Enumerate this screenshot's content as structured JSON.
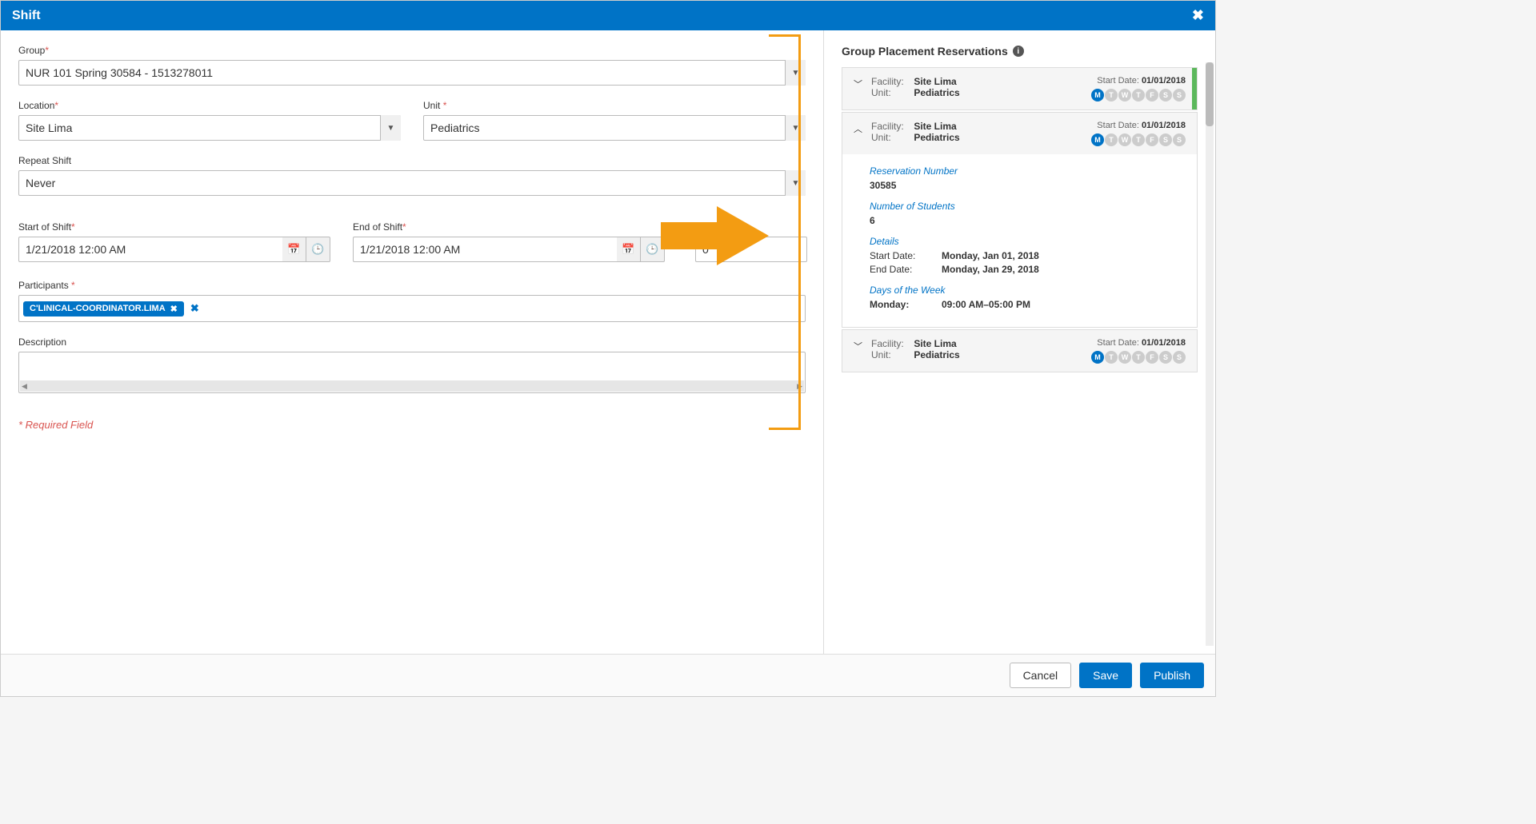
{
  "dialog": {
    "title": "Shift",
    "form": {
      "group_label": "Group",
      "group_value": "NUR 101 Spring 30584 - 1513278011",
      "location_label": "Location",
      "location_value": "Site Lima",
      "unit_label": "Unit",
      "unit_value": "Pediatrics",
      "repeat_label": "Repeat Shift",
      "repeat_value": "Never",
      "start_label": "Start of Shift",
      "start_value": "1/21/2018 12:00 AM",
      "end_label": "End of Shift",
      "end_value": "1/21/2018 12:00 AM",
      "duration_value": "0",
      "participants_label": "Participants",
      "participant_tag": "C'LINICAL-COORDINATOR.LIMA",
      "description_label": "Description",
      "required_note": "* Required Field"
    },
    "footer": {
      "cancel": "Cancel",
      "save": "Save",
      "publish": "Publish"
    }
  },
  "reservations": {
    "title": "Group Placement Reservations",
    "day_labels": [
      "M",
      "T",
      "W",
      "T",
      "F",
      "S",
      "S"
    ],
    "cards": [
      {
        "expanded": false,
        "facility_label": "Facility:",
        "facility": "Site Lima",
        "unit_label": "Unit:",
        "unit": "Pediatrics",
        "start_date_label": "Start Date:",
        "start_date": "01/01/2018",
        "days_active": [
          true,
          false,
          false,
          false,
          false,
          false,
          false
        ],
        "green": true
      },
      {
        "expanded": true,
        "facility_label": "Facility:",
        "facility": "Site Lima",
        "unit_label": "Unit:",
        "unit": "Pediatrics",
        "start_date_label": "Start Date:",
        "start_date": "01/01/2018",
        "days_active": [
          true,
          false,
          false,
          false,
          false,
          false,
          false
        ],
        "green": false,
        "body": {
          "res_num_label": "Reservation Number",
          "res_num": "30585",
          "num_students_label": "Number of Students",
          "num_students": "6",
          "details_label": "Details",
          "start_date_k": "Start Date:",
          "start_date_v": "Monday, Jan 01, 2018",
          "end_date_k": "End Date:",
          "end_date_v": "Monday, Jan 29, 2018",
          "dow_label": "Days of the Week",
          "dow_k": "Monday:",
          "dow_v": "09:00 AM–05:00 PM"
        }
      },
      {
        "expanded": false,
        "facility_label": "Facility:",
        "facility": "Site Lima",
        "unit_label": "Unit:",
        "unit": "Pediatrics",
        "start_date_label": "Start Date:",
        "start_date": "01/01/2018",
        "days_active": [
          true,
          false,
          false,
          false,
          false,
          false,
          false
        ],
        "green": false
      }
    ]
  }
}
